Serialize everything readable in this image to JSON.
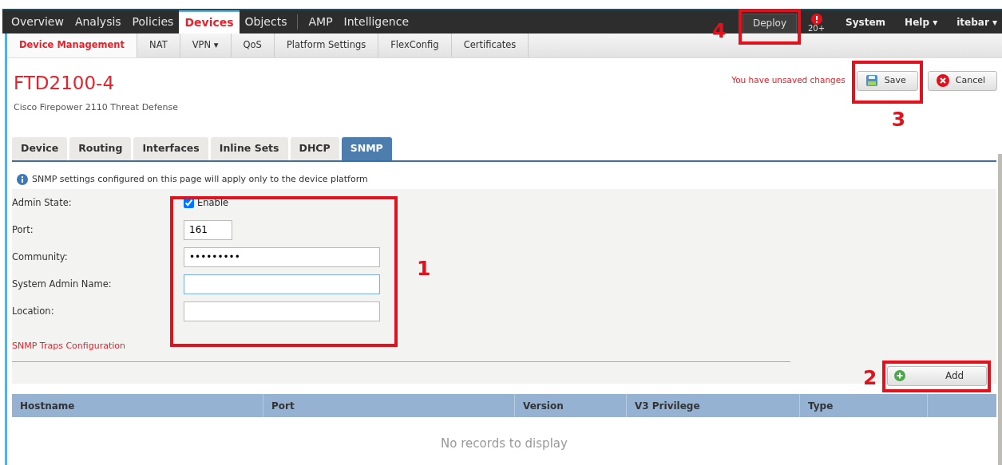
{
  "top_nav": {
    "items": [
      {
        "label": "Overview",
        "selected": false,
        "separator_before": false
      },
      {
        "label": "Analysis",
        "selected": false,
        "separator_before": false
      },
      {
        "label": "Policies",
        "selected": false,
        "separator_before": false
      },
      {
        "label": "Devices",
        "selected": true,
        "separator_before": false
      },
      {
        "label": "Objects",
        "selected": false,
        "separator_before": false
      },
      {
        "label": "AMP",
        "selected": false,
        "separator_before": true
      },
      {
        "label": "Intelligence",
        "selected": false,
        "separator_before": false
      }
    ],
    "deploy_button": "Deploy",
    "alert_count": "20+",
    "menus": [
      {
        "label": "System"
      },
      {
        "label": "Help",
        "caret": "▾"
      },
      {
        "label": "itebar",
        "caret": "▾"
      }
    ]
  },
  "sub_nav": {
    "items": [
      {
        "label": "Device Management",
        "selected": true
      },
      {
        "label": "NAT",
        "selected": false
      },
      {
        "label": "VPN",
        "selected": false,
        "caret": "▾"
      },
      {
        "label": "QoS",
        "selected": false
      },
      {
        "label": "Platform Settings",
        "selected": false
      },
      {
        "label": "FlexConfig",
        "selected": false
      },
      {
        "label": "Certificates",
        "selected": false
      }
    ]
  },
  "device": {
    "title": "FTD2100-4",
    "subtitle": "Cisco Firepower 2110 Threat Defense"
  },
  "unsaved_message": "You have unsaved changes",
  "save_button": "Save",
  "cancel_button": "Cancel",
  "device_tabs": [
    {
      "label": "Device",
      "selected": false
    },
    {
      "label": "Routing",
      "selected": false
    },
    {
      "label": "Interfaces",
      "selected": false
    },
    {
      "label": "Inline Sets",
      "selected": false
    },
    {
      "label": "DHCP",
      "selected": false
    },
    {
      "label": "SNMP",
      "selected": true
    }
  ],
  "info_message": "SNMP settings configured on this page will apply only to the device platform",
  "form": [
    {
      "kind": "checkbox",
      "label": "Admin State:",
      "option": "Enable",
      "checked": true
    },
    {
      "kind": "short",
      "label": "Port:",
      "value": "161",
      "focused": false
    },
    {
      "kind": "text",
      "label": "Community:",
      "value": "•••••••••",
      "focused": false
    },
    {
      "kind": "text",
      "label": "System Admin Name:",
      "focused": true
    },
    {
      "kind": "text",
      "label": "Location:",
      "focused": false
    }
  ],
  "traps_link": "SNMP Traps Configuration",
  "add_button": "Add",
  "table": {
    "columns": [
      "Hostname",
      "Port",
      "Version",
      "V3 Privilege",
      "Type"
    ],
    "empty_message": "No records to display"
  },
  "annotations": [
    {
      "label": "1"
    },
    {
      "label": "2"
    },
    {
      "label": "3"
    },
    {
      "label": "4"
    }
  ]
}
